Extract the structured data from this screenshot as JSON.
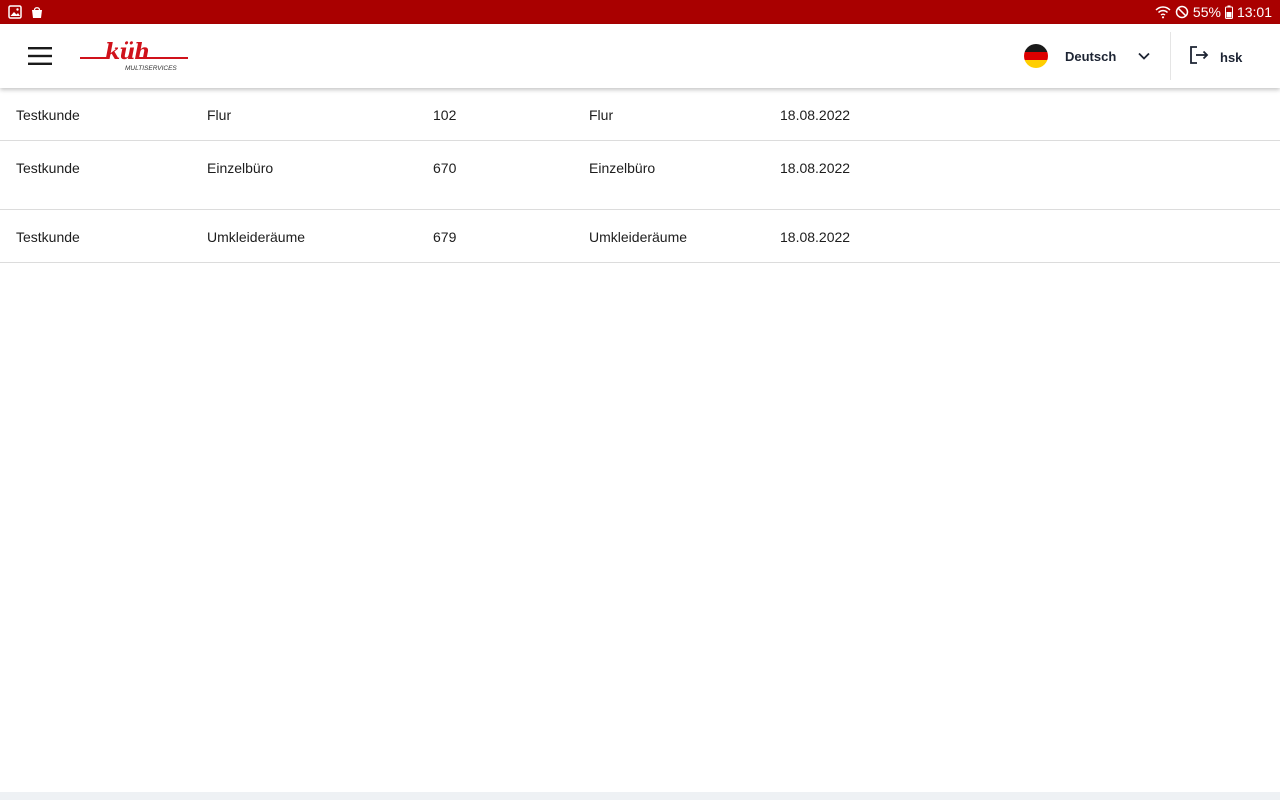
{
  "status_bar": {
    "icons_left": [
      "image-icon",
      "shopping-bag-icon"
    ],
    "icons_right": [
      "wifi-icon",
      "do-not-disturb-icon",
      "battery-icon"
    ],
    "battery": "55%",
    "time": "13:01",
    "background": "#a90000"
  },
  "header": {
    "menu_icon": "hamburger-menu-icon",
    "logo_text": "küh",
    "logo_sub": "MULTISERVICES",
    "language": {
      "flag": "germany-flag-icon",
      "label": "Deutsch",
      "chevron": "chevron-down-icon"
    },
    "logout": {
      "icon": "logout-icon",
      "label": "hsk"
    },
    "brand_color": "#d0121b"
  },
  "rows": [
    {
      "customer": "Testkunde",
      "area": "Flur",
      "number": "102",
      "room": "Flur",
      "date": "18.08.2022"
    },
    {
      "customer": "Testkunde",
      "area": "Einzelbüro",
      "number": "670",
      "room": "Einzelbüro",
      "date": "18.08.2022"
    },
    {
      "customer": "Testkunde",
      "area": "Umkleideräume",
      "number": "679",
      "room": "Umkleideräume",
      "date": "18.08.2022"
    }
  ]
}
